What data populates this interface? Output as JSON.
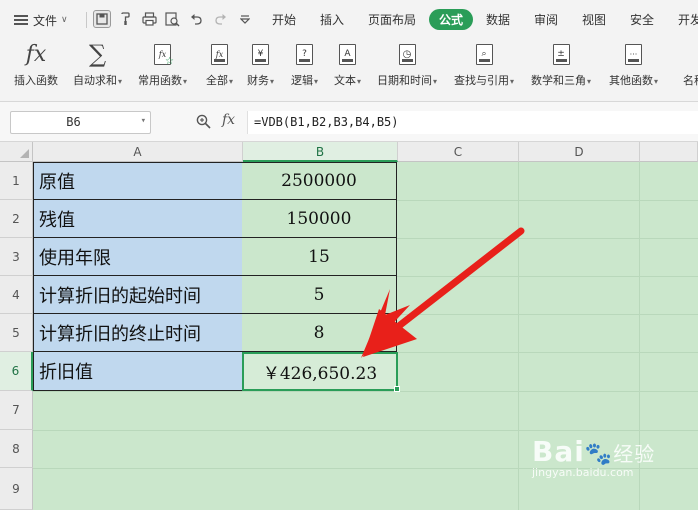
{
  "menubar": {
    "file_label": "文件",
    "tabs": [
      "开始",
      "插入",
      "页面布局",
      "公式",
      "数据",
      "审阅",
      "视图",
      "安全",
      "开发"
    ],
    "active_tab": "公式",
    "accent": "#2a9d58"
  },
  "ribbon": {
    "buttons": [
      {
        "label": "插入函数",
        "icon": "fx-icon"
      },
      {
        "label": "自动求和",
        "icon": "sigma-icon"
      },
      {
        "label": "常用函数",
        "icon": "favorite-function-icon"
      },
      {
        "label": "全部",
        "icon": "all-functions-icon"
      },
      {
        "label": "财务",
        "icon": "finance-icon"
      },
      {
        "label": "逻辑",
        "icon": "logic-icon"
      },
      {
        "label": "文本",
        "icon": "text-icon"
      },
      {
        "label": "日期和时间",
        "icon": "clock-icon"
      },
      {
        "label": "查找与引用",
        "icon": "lookup-icon"
      },
      {
        "label": "数学和三角",
        "icon": "math-icon"
      },
      {
        "label": "其他函数",
        "icon": "more-functions-icon"
      },
      {
        "label": "名称",
        "icon": "name-icon"
      }
    ],
    "icon_text": {
      "all": "fx",
      "finance": "¥",
      "logic": "?",
      "text": "A"
    }
  },
  "formula_bar": {
    "name_box": "B6",
    "fx_label": "fx",
    "formula": "=VDB(B1,B2,B3,B4,B5)"
  },
  "sheet": {
    "columns": [
      "A",
      "B",
      "C",
      "D"
    ],
    "rows": [
      "1",
      "2",
      "3",
      "4",
      "5",
      "6",
      "7",
      "8",
      "9"
    ],
    "selected_cell": "B6",
    "table": [
      {
        "label": "原值",
        "value": "2500000"
      },
      {
        "label": "残值",
        "value": "150000"
      },
      {
        "label": "使用年限",
        "value": "15"
      },
      {
        "label": "计算折旧的起始时间",
        "value": "5"
      },
      {
        "label": "计算折旧的终止时间",
        "value": "8"
      },
      {
        "label": "折旧值",
        "value": "￥426,650.23"
      }
    ],
    "colors": {
      "label_fill": "#c0d8ee",
      "sheet_fill": "#cbe7cc",
      "arrow": "#e8201a"
    }
  },
  "watermark": {
    "brand": "Bai",
    "brand_cn": "经验",
    "url": "jingyan.baidu.com"
  }
}
